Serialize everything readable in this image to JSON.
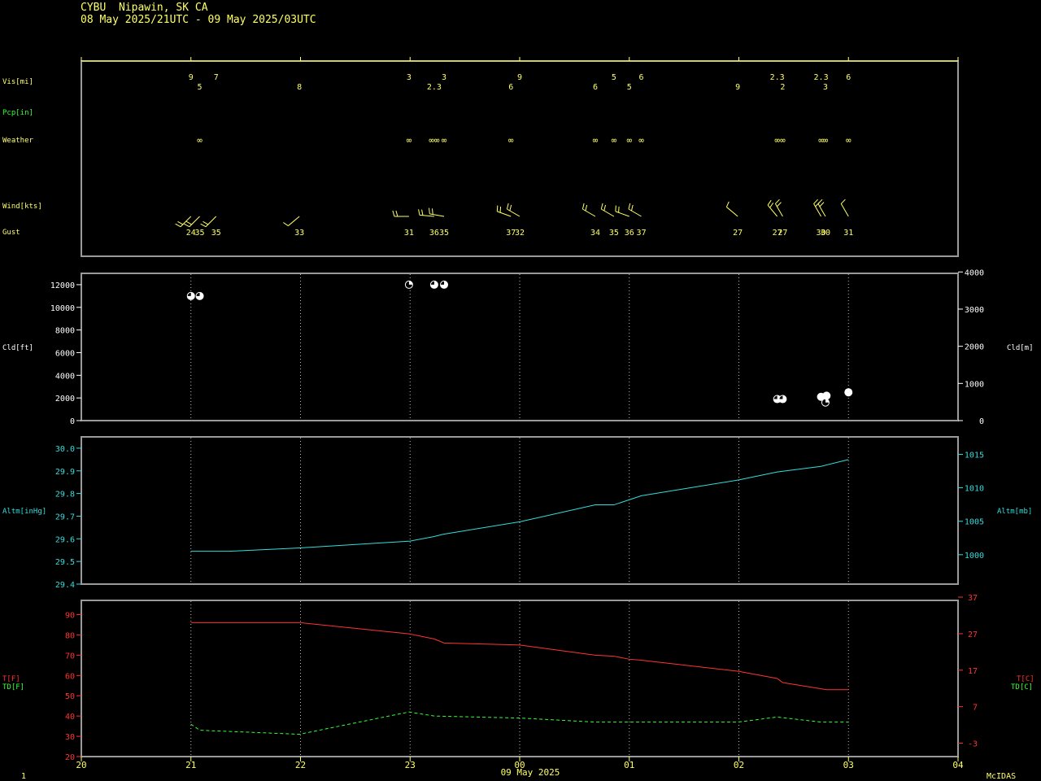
{
  "header": {
    "station": "CYBU  Nipawin, SK CA",
    "period": "08 May 2025/21UTC - 09 May 2025/03UTC"
  },
  "footer": {
    "page_number": "1",
    "brand": "McIDAS",
    "date_label": "09 May 2025"
  },
  "colors": {
    "yellow": "#ffff66",
    "green": "#33ff33",
    "cyan": "#33dddd",
    "red": "#ff3333",
    "white": "#ffffff",
    "frame": "#9a9a9a"
  },
  "chart_data": [
    {
      "type": "table",
      "title": "",
      "rows": {
        "vis": "Vis[mi]",
        "pcp": "Pcp[in]",
        "weather": "Weather",
        "wind": "Wind[kts]",
        "gust": "Gust"
      },
      "weather_symbol": "∞",
      "observations": [
        {
          "x": 21.0,
          "vis": "9",
          "vis_row": 0,
          "wx": "",
          "wind_dir": 225,
          "wind_kts": 20,
          "gust": "24"
        },
        {
          "x": 21.08,
          "vis": "5",
          "vis_row": 1,
          "wx": "∞",
          "wind_dir": 225,
          "wind_kts": 20,
          "gust": "35"
        },
        {
          "x": 21.23,
          "vis": "7",
          "vis_row": 0,
          "wx": "",
          "wind_dir": 225,
          "wind_kts": 15,
          "gust": "35"
        },
        {
          "x": 21.99,
          "vis": "8",
          "vis_row": 1,
          "wx": "",
          "wind_dir": 230,
          "wind_kts": 10,
          "gust": "33"
        },
        {
          "x": 22.99,
          "vis": "3",
          "vis_row": 0,
          "wx": "∞",
          "wind_dir": 270,
          "wind_kts": 20,
          "gust": "31"
        },
        {
          "x": 23.22,
          "vis": "2.3",
          "vis_row": 1,
          "wx": "∞∞",
          "wind_dir": 275,
          "wind_kts": 20,
          "gust": "36"
        },
        {
          "x": 23.31,
          "vis": "3",
          "vis_row": 0,
          "wx": "∞",
          "wind_dir": 280,
          "wind_kts": 20,
          "gust": "35"
        },
        {
          "x": 23.92,
          "vis": "6",
          "vis_row": 1,
          "wx": "∞",
          "wind_dir": 290,
          "wind_kts": 20,
          "gust": "37"
        },
        {
          "x": 24.0,
          "vis": "9",
          "vis_row": 0,
          "wx": "",
          "wind_dir": 300,
          "wind_kts": 20,
          "gust": "32"
        },
        {
          "x": 24.69,
          "vis": "6",
          "vis_row": 1,
          "wx": "∞",
          "wind_dir": 300,
          "wind_kts": 15,
          "gust": "34"
        },
        {
          "x": 24.86,
          "vis": "5",
          "vis_row": 0,
          "wx": "∞",
          "wind_dir": 300,
          "wind_kts": 15,
          "gust": "35"
        },
        {
          "x": 25.0,
          "vis": "5",
          "vis_row": 1,
          "wx": "∞",
          "wind_dir": 290,
          "wind_kts": 15,
          "gust": "36"
        },
        {
          "x": 25.11,
          "vis": "6",
          "vis_row": 0,
          "wx": "∞",
          "wind_dir": 300,
          "wind_kts": 15,
          "gust": "37"
        },
        {
          "x": 25.99,
          "vis": "9",
          "vis_row": 1,
          "wx": "",
          "wind_dir": 310,
          "wind_kts": 10,
          "gust": "27"
        },
        {
          "x": 26.35,
          "vis": "2.3",
          "vis_row": 0,
          "wx": "∞",
          "wind_dir": 320,
          "wind_kts": 15,
          "gust": "27"
        },
        {
          "x": 26.4,
          "vis": "2",
          "vis_row": 1,
          "wx": "∞",
          "wind_dir": 330,
          "wind_kts": 15,
          "gust": "27"
        },
        {
          "x": 26.75,
          "vis": "2.3",
          "vis_row": 0,
          "wx": "∞",
          "wind_dir": 330,
          "wind_kts": 15,
          "gust": "30"
        },
        {
          "x": 26.79,
          "vis": "3",
          "vis_row": 1,
          "wx": "∞",
          "wind_dir": 330,
          "wind_kts": 15,
          "gust": "30"
        },
        {
          "x": 27.0,
          "vis": "6",
          "vis_row": 0,
          "wx": "∞",
          "wind_dir": 330,
          "wind_kts": 10,
          "gust": "31"
        }
      ]
    },
    {
      "type": "scatter",
      "ylabel": "Cld[ft]",
      "y2label": "Cld[m]",
      "ylim": [
        0,
        13000
      ],
      "yticks": [
        0,
        2000,
        4000,
        6000,
        8000,
        10000,
        12000
      ],
      "y2ticks": [
        0,
        1000,
        2000,
        3000,
        4000
      ],
      "points": [
        {
          "x": 21.0,
          "y": 11000,
          "cover": "broken"
        },
        {
          "x": 21.08,
          "y": 11000,
          "cover": "broken"
        },
        {
          "x": 22.99,
          "y": 12000,
          "cover": "scattered"
        },
        {
          "x": 23.22,
          "y": 12000,
          "cover": "broken"
        },
        {
          "x": 23.31,
          "y": 12000,
          "cover": "broken"
        },
        {
          "x": 26.35,
          "y": 1900,
          "cover": "broken"
        },
        {
          "x": 26.4,
          "y": 1900,
          "cover": "broken"
        },
        {
          "x": 26.75,
          "y": 2100,
          "cover": "overcast"
        },
        {
          "x": 26.79,
          "y": 1600,
          "cover": "scattered"
        },
        {
          "x": 26.8,
          "y": 2200,
          "cover": "overcast"
        },
        {
          "x": 27.0,
          "y": 2500,
          "cover": "overcast"
        }
      ]
    },
    {
      "type": "line",
      "ylabel": "Altm[inHg]",
      "y2label": "Altm[mb]",
      "ylim": [
        29.4,
        30.05
      ],
      "yticks": [
        29.4,
        29.5,
        29.6,
        29.7,
        29.8,
        29.9,
        30.0
      ],
      "y2ticks": [
        1000,
        1005,
        1010,
        1015
      ],
      "series": [
        {
          "x": [
            21.0,
            21.35,
            22.0,
            23.0,
            23.22,
            23.3,
            24.0,
            24.69,
            24.86,
            25.11,
            26.0,
            26.35,
            26.75,
            27.0
          ],
          "y": [
            29.545,
            29.545,
            29.56,
            29.59,
            29.61,
            29.62,
            29.675,
            29.75,
            29.75,
            29.79,
            29.86,
            29.895,
            29.92,
            29.95
          ]
        }
      ]
    },
    {
      "type": "line",
      "ylabel": "T[F]",
      "ylabel2": "TD[F]",
      "y2label": "T[C]",
      "y2label2": "TD[C]",
      "ylim": [
        20,
        97
      ],
      "yticks": [
        20,
        30,
        40,
        50,
        60,
        70,
        80,
        90
      ],
      "y2ticks": [
        -3,
        7,
        17,
        27,
        37
      ],
      "series": [
        {
          "name": "T",
          "x": [
            21.0,
            22.0,
            22.99,
            23.22,
            23.31,
            24.0,
            24.69,
            24.86,
            25.0,
            25.11,
            26.0,
            26.35,
            26.4,
            26.8,
            27.0
          ],
          "y": [
            86,
            86,
            80.5,
            78,
            76,
            75,
            70,
            69.5,
            68,
            67.5,
            62,
            58.5,
            56.5,
            53,
            53
          ]
        },
        {
          "name": "TD",
          "x": [
            21.0,
            21.08,
            21.99,
            22.99,
            23.22,
            24.0,
            24.69,
            25.0,
            25.99,
            26.35,
            26.75,
            27.0
          ],
          "y": [
            36,
            33,
            31,
            42,
            40,
            39,
            37,
            37,
            37,
            39.5,
            37,
            37
          ]
        }
      ]
    }
  ],
  "x_axis": {
    "start": 20,
    "end": 28,
    "tick_labels": [
      "20",
      "21",
      "22",
      "23",
      "00",
      "01",
      "02",
      "03",
      "04"
    ],
    "grid_from": 21,
    "grid_to": 27
  }
}
